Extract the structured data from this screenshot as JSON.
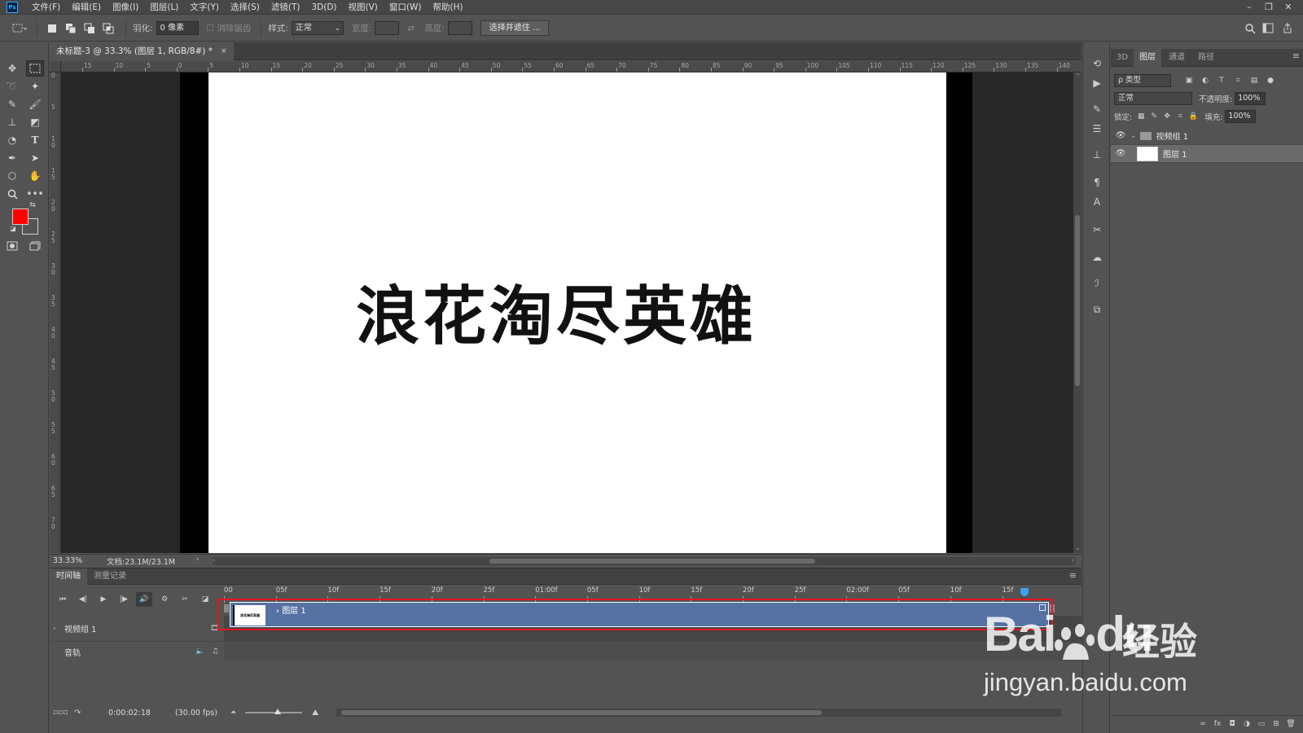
{
  "app": {
    "logo": "Ps"
  },
  "menu": [
    "文件(F)",
    "编辑(E)",
    "图像(I)",
    "图层(L)",
    "文字(Y)",
    "选择(S)",
    "滤镜(T)",
    "3D(D)",
    "视图(V)",
    "窗口(W)",
    "帮助(H)"
  ],
  "window_controls": {
    "minimize": "–",
    "restore": "❐",
    "close": "✕"
  },
  "options": {
    "feather_label": "羽化:",
    "feather_value": "0 像素",
    "antialias_label": "消除锯齿",
    "style_label": "样式:",
    "style_value": "正常",
    "width_label": "宽度:",
    "height_label": "高度:",
    "select_mask_button": "选择并遮住 ..."
  },
  "document": {
    "tab_title": "未标题-3 @ 33.3% (图层 1, RGB/8#) *",
    "close": "×",
    "canvas_text": "浪花淘尽英雄"
  },
  "ruler_h_ticks": [
    "15",
    "10",
    "5",
    "0",
    "5",
    "10",
    "15",
    "20",
    "25",
    "30",
    "35",
    "40",
    "45",
    "50",
    "55",
    "60",
    "65",
    "70",
    "75",
    "80",
    "85",
    "90",
    "95",
    "100",
    "105",
    "110",
    "115",
    "120",
    "125",
    "130",
    "135",
    "140"
  ],
  "ruler_v_ticks": [
    "0",
    "5",
    "1\n0",
    "1\n5",
    "2\n0",
    "2\n5",
    "3\n0",
    "3\n5",
    "4\n0",
    "4\n5",
    "5\n0",
    "5\n5",
    "6\n0",
    "6\n5",
    "7\n0"
  ],
  "status": {
    "zoom": "33.33%",
    "doc_size": "文档:23.1M/23.1M"
  },
  "timeline": {
    "tabs": [
      "时间轴",
      "测量记录"
    ],
    "ticks": [
      "00",
      "05f",
      "10f",
      "15f",
      "20f",
      "25f",
      "01:00f",
      "05f",
      "10f",
      "15f",
      "20f",
      "25f",
      "02:00f",
      "05f",
      "10f",
      "15f"
    ],
    "video_group": "视频组 1",
    "audio_track": "音轨",
    "clip_label": "图层 1",
    "clip_thumb_text": "浪花淘尽英雄",
    "timecode": "0:00:02:18",
    "fps": "(30.00 fps)"
  },
  "layers_panel": {
    "tabs": [
      "3D",
      "图层",
      "通道",
      "路径"
    ],
    "filter_kind": "ρ 类型",
    "blend_mode": "正常",
    "opacity_label": "不透明度:",
    "opacity_value": "100%",
    "lock_label": "锁定:",
    "fill_label": "填充:",
    "fill_value": "100%",
    "layers": [
      {
        "name": "视频组 1",
        "type": "group"
      },
      {
        "name": "图层 1",
        "type": "layer"
      }
    ]
  },
  "watermark": {
    "logo": "Bai",
    "logo_paw": "du",
    "cn": "经验",
    "url": "jingyan.baidu.com"
  },
  "colors": {
    "foreground": "#ff0000",
    "clip": "#5572a3",
    "highlight": "#e8141f",
    "playhead": "#3aa0f0"
  }
}
